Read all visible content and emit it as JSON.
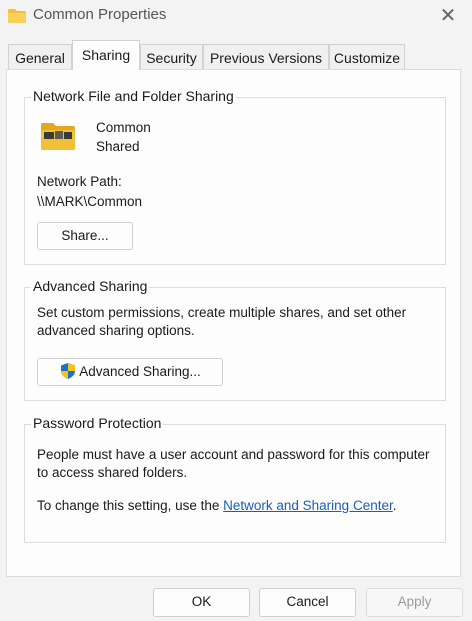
{
  "window": {
    "title": "Common Properties",
    "close_icon": "close-icon"
  },
  "tabs": [
    {
      "label": "General"
    },
    {
      "label": "Sharing",
      "active": true
    },
    {
      "label": "Security"
    },
    {
      "label": "Previous Versions"
    },
    {
      "label": "Customize"
    }
  ],
  "network_sharing": {
    "group_title": "Network File and Folder Sharing",
    "folder_name": "Common",
    "folder_status": "Shared",
    "path_label": "Network Path:",
    "path_value": "\\\\MARK\\Common",
    "share_button": "Share..."
  },
  "advanced_sharing": {
    "group_title": "Advanced Sharing",
    "description_line1": "Set custom permissions, create multiple shares, and set other",
    "description_line2": "advanced sharing options.",
    "button_label": "Advanced Sharing..."
  },
  "password_protection": {
    "group_title": "Password Protection",
    "description_line1": "People must have a user account and password for this computer",
    "description_line2": "to access shared folders.",
    "change_prefix": "To change this setting, use the ",
    "link_text": "Network and Sharing Center",
    "change_suffix": "."
  },
  "footer": {
    "ok": "OK",
    "cancel": "Cancel",
    "apply": "Apply"
  },
  "colors": {
    "link": "#1a5fb4",
    "folder": "#f2c037",
    "shield_blue": "#1a73c9",
    "shield_yellow": "#f7c21a"
  }
}
